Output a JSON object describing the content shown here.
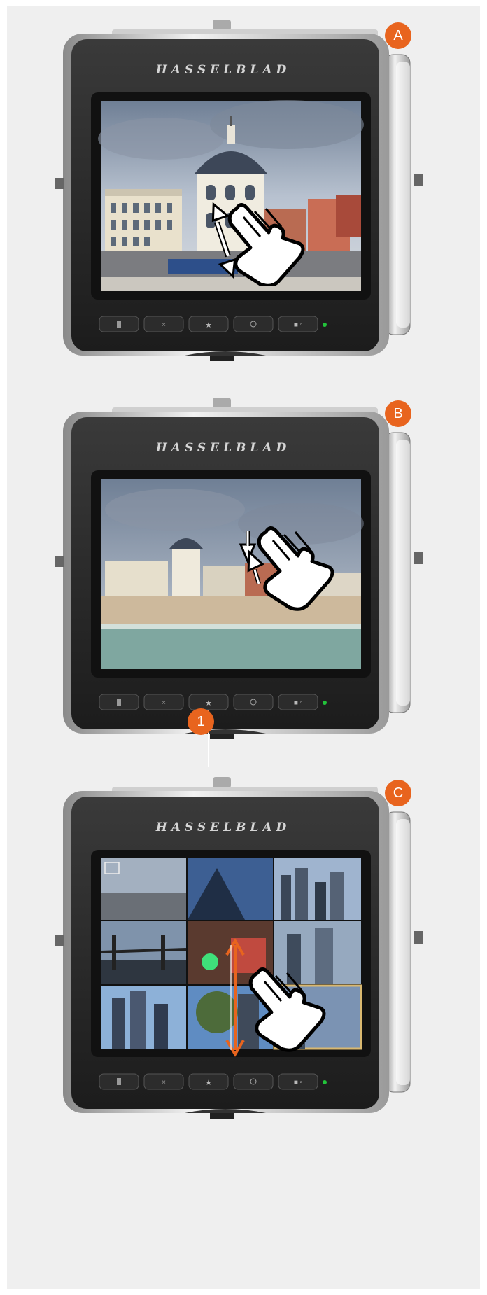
{
  "brand": "HASSELBLAD",
  "colors": {
    "accent": "#e8641e",
    "background": "#efefef",
    "led": "#22c33a",
    "highlight_frame": "#d9b870"
  },
  "panels": [
    {
      "label": "A",
      "screen": "zoomed-in-dome-building",
      "gesture": "two-finger-spread",
      "icons": [
        "hand-pointer-icon",
        "double-arrow-icon"
      ]
    },
    {
      "label": "B",
      "screen": "full-beach-and-dome-view",
      "gesture": "two-finger-pinch",
      "icons": [
        "hand-pointer-icon",
        "pinch-arrows-icon"
      ],
      "callout": "1"
    },
    {
      "label": "C",
      "screen": "thumbnail-grid-3x3",
      "gesture": "swipe-vertical",
      "icons": [
        "hand-pointer-icon",
        "vertical-double-arrow-icon",
        "focus-frame-icon"
      ]
    }
  ],
  "buttons": [
    "menu-button",
    "cross-button",
    "star-button",
    "camera-button",
    "play-button"
  ]
}
